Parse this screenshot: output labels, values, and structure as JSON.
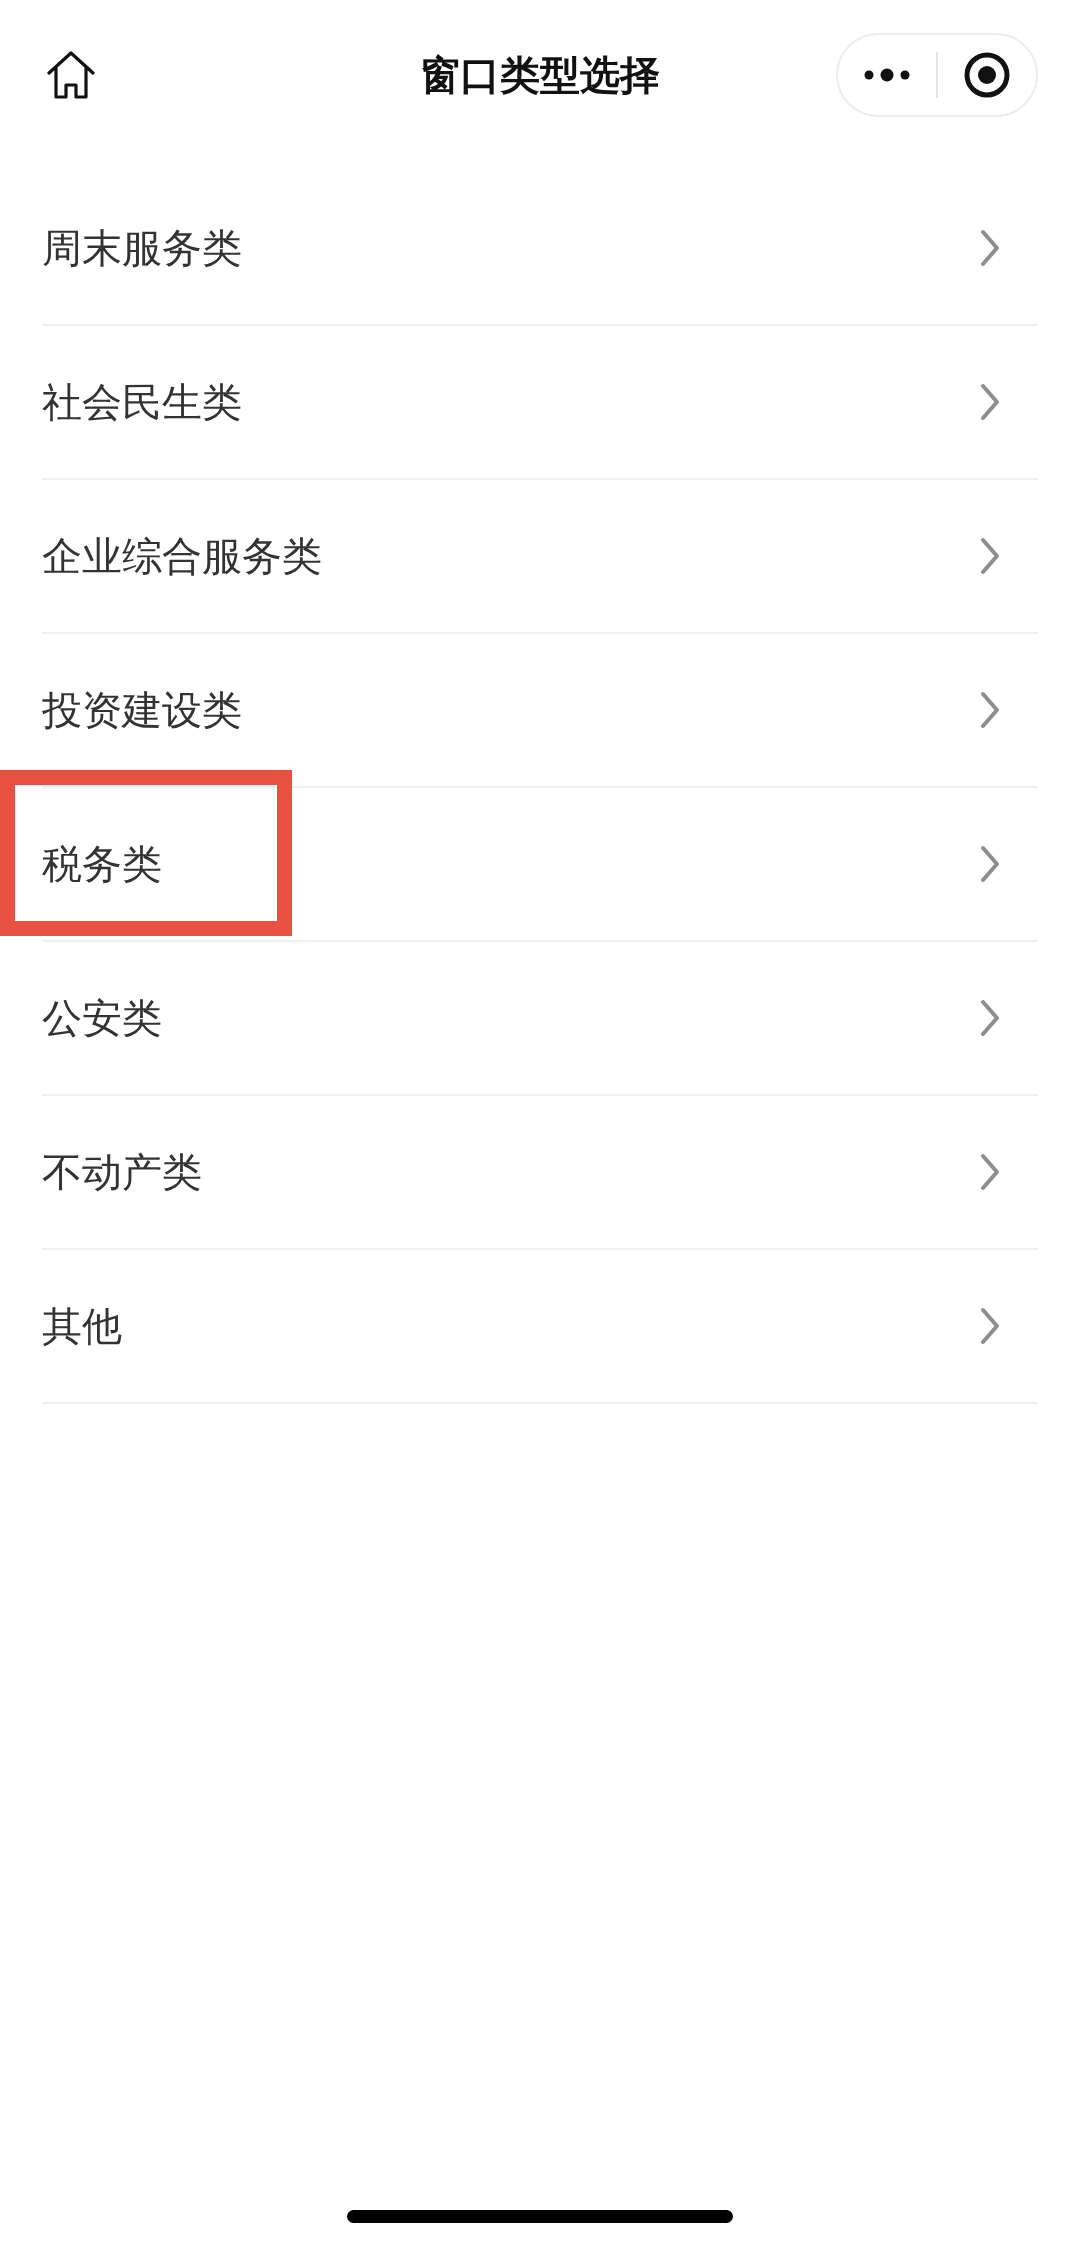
{
  "nav": {
    "title": "窗口类型选择"
  },
  "items": [
    {
      "label": "周末服务类",
      "highlighted": false
    },
    {
      "label": "社会民生类",
      "highlighted": false
    },
    {
      "label": "企业综合服务类",
      "highlighted": false
    },
    {
      "label": "投资建设类",
      "highlighted": false
    },
    {
      "label": "税务类",
      "highlighted": true
    },
    {
      "label": "公安类",
      "highlighted": false
    },
    {
      "label": "不动产类",
      "highlighted": false
    },
    {
      "label": "其他",
      "highlighted": false
    }
  ]
}
